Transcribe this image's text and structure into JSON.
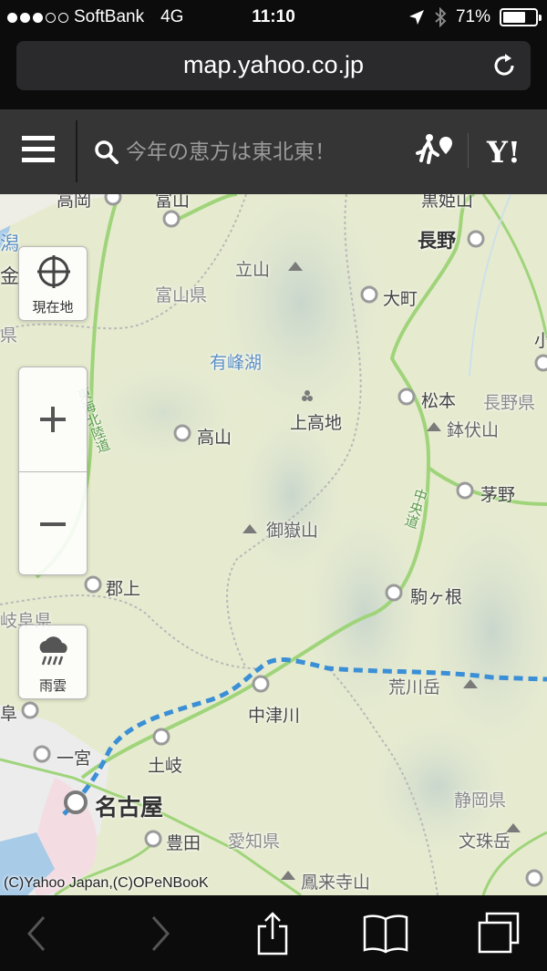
{
  "status_bar": {
    "carrier": "SoftBank",
    "network": "4G",
    "time": "11:10",
    "battery_percent": "71%",
    "battery_level": 0.71,
    "signal_bars_filled": 3,
    "signal_bars_total": 5
  },
  "browser": {
    "url": "map.yahoo.co.jp"
  },
  "header": {
    "search_placeholder": "今年の恵方は東北東！",
    "logo_text": "Y!"
  },
  "map": {
    "labels": {
      "takaoka": "高岡",
      "toyama": "富山",
      "kurohime": "黒姫山",
      "nagano": "長野",
      "kana": "金",
      "niigata_part": "潟",
      "tateyama": "立山",
      "toyama_pref": "富山県",
      "omachi": "大町",
      "ken_left": "県",
      "arimine": "有峰湖",
      "matsumoto": "松本",
      "nagano_pref": "長野県",
      "kamikochi": "上高地",
      "takayama": "高山",
      "hachibuse": "鉢伏山",
      "chino": "茅野",
      "ontake": "御嶽山",
      "gujo": "郡上",
      "komagane": "駒ヶ根",
      "gifu_pref": "岐阜県",
      "arakawa": "荒川岳",
      "nakatsugawa": "中津川",
      "gifu_left": "阜",
      "ichinomiya": "一宮",
      "toki": "土岐",
      "nagoya": "名古屋",
      "shizuoka_pref": "静岡県",
      "toyota": "豊田",
      "aichi_pref": "愛知県",
      "bunju": "文珠岳",
      "horaiji": "鳳来寺山",
      "ko_right": "小",
      "expressway_tokai": "東海北陸道",
      "expressway_chuo": "中央道"
    },
    "copyright": "(C)Yahoo Japan,(C)OPeNBooK"
  },
  "controls": {
    "current_location_label": "現在地",
    "rain_cloud_label": "雨雲"
  }
}
